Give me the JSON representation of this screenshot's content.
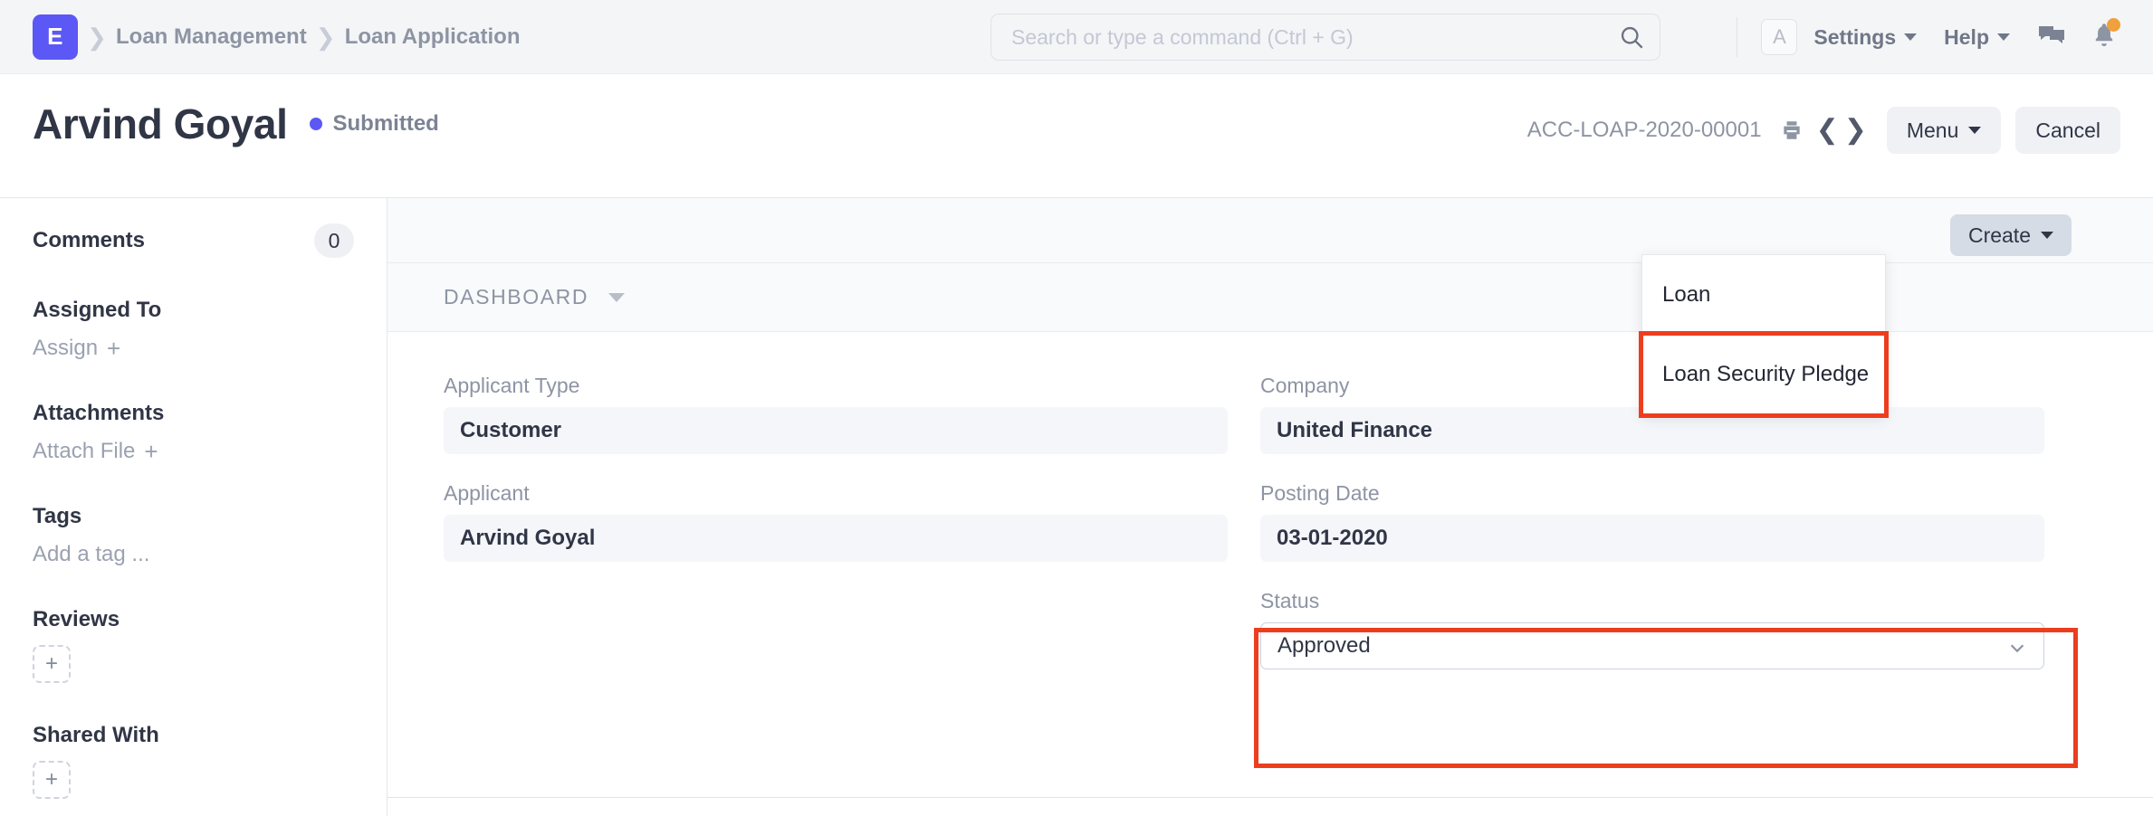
{
  "navbar": {
    "logo_text": "E",
    "logo_color": "#5b58f5",
    "breadcrumbs": [
      {
        "label": "Loan Management"
      },
      {
        "label": "Loan Application"
      }
    ],
    "search": {
      "placeholder": "Search or type a command (Ctrl + G)",
      "value": ""
    },
    "avatar_initial": "A",
    "settings_label": "Settings",
    "help_label": "Help",
    "notification_dot_color": "#f0a03c"
  },
  "page_header": {
    "title": "Arvind Goyal",
    "status": "Submitted",
    "status_color": "#5b58f5",
    "doc_id": "ACC-LOAP-2020-00001",
    "menu_label": "Menu",
    "cancel_label": "Cancel"
  },
  "sidebar": {
    "comments": {
      "label": "Comments",
      "count": "0"
    },
    "assigned_to": {
      "label": "Assigned To",
      "action": "Assign",
      "plus": "+"
    },
    "attachments": {
      "label": "Attachments",
      "action": "Attach File",
      "plus": "+"
    },
    "tags": {
      "label": "Tags",
      "action": "Add a tag ..."
    },
    "reviews": {
      "label": "Reviews",
      "plus": "+"
    },
    "shared_with": {
      "label": "Shared With",
      "plus": "+"
    }
  },
  "main": {
    "create_button": "Create",
    "tab_label": "DASHBOARD",
    "create_menu": {
      "items": [
        {
          "label": "Loan",
          "highlighted": false
        },
        {
          "label": "Loan Security Pledge",
          "highlighted": true
        }
      ],
      "highlight_color": "#ec3e1f"
    },
    "fields": {
      "applicant_type": {
        "label": "Applicant Type",
        "value": "Customer"
      },
      "applicant": {
        "label": "Applicant",
        "value": "Arvind Goyal"
      },
      "company": {
        "label": "Company",
        "value": "United Finance"
      },
      "posting_date": {
        "label": "Posting Date",
        "value": "03-01-2020"
      },
      "status": {
        "label": "Status",
        "value": "Approved",
        "highlighted": true
      }
    }
  }
}
